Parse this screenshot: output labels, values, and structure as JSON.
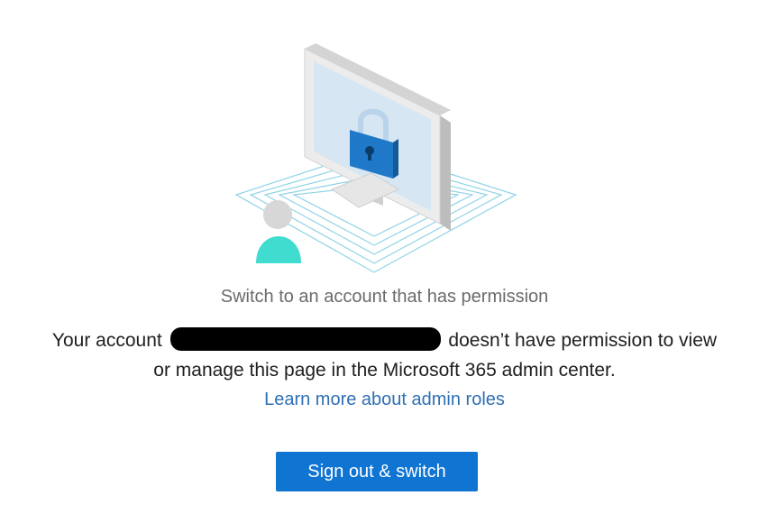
{
  "message": {
    "title": "Switch to an account that has permission",
    "line1_prefix": "Your account",
    "line1_suffix": "doesn’t have permission to view",
    "line2": "or manage this page in the Microsoft 365 admin center."
  },
  "learn_more": {
    "label": "Learn more about admin roles"
  },
  "action": {
    "sign_out_label": "Sign out & switch"
  },
  "illustration": {
    "icons": [
      "monitor-icon",
      "padlock-icon",
      "user-icon"
    ],
    "colors": {
      "monitor_frame": "#e9e9e9",
      "monitor_side": "#bdbdbd",
      "screen": "#d6e6f2",
      "lock_body": "#1f78c8",
      "user_body": "#3fdccf",
      "user_head": "#d7d7d7",
      "grid_lines": "#8fd3e6"
    }
  },
  "colors": {
    "link": "#2f6fb4",
    "button": "#0f74d2",
    "subtitle": "#6b6b6b",
    "text": "#202020"
  }
}
